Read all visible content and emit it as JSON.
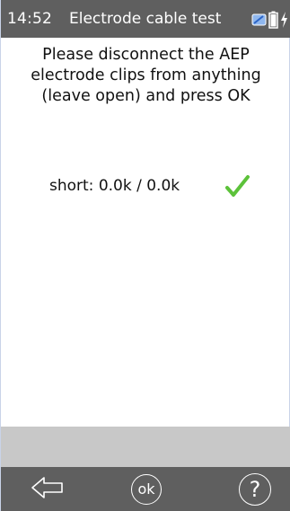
{
  "status_bar": {
    "time": "14:52",
    "title": "Electrode cable test",
    "icons": [
      "device-link-icon",
      "battery-icon",
      "charging-icon"
    ]
  },
  "main": {
    "instruction": "Please disconnect the AEP electrode clips from anything (leave open) and press OK",
    "result": {
      "label": "short: 0.0k / 0.0k",
      "status_icon": "checkmark-icon",
      "status_color": "#5cc23a"
    }
  },
  "nav": {
    "back_icon": "back-arrow-icon",
    "ok_label": "ok",
    "help_label": "?"
  },
  "colors": {
    "bar_background": "#5f5f5f",
    "footer_strip": "#c8c8c8",
    "text": "#111111"
  }
}
